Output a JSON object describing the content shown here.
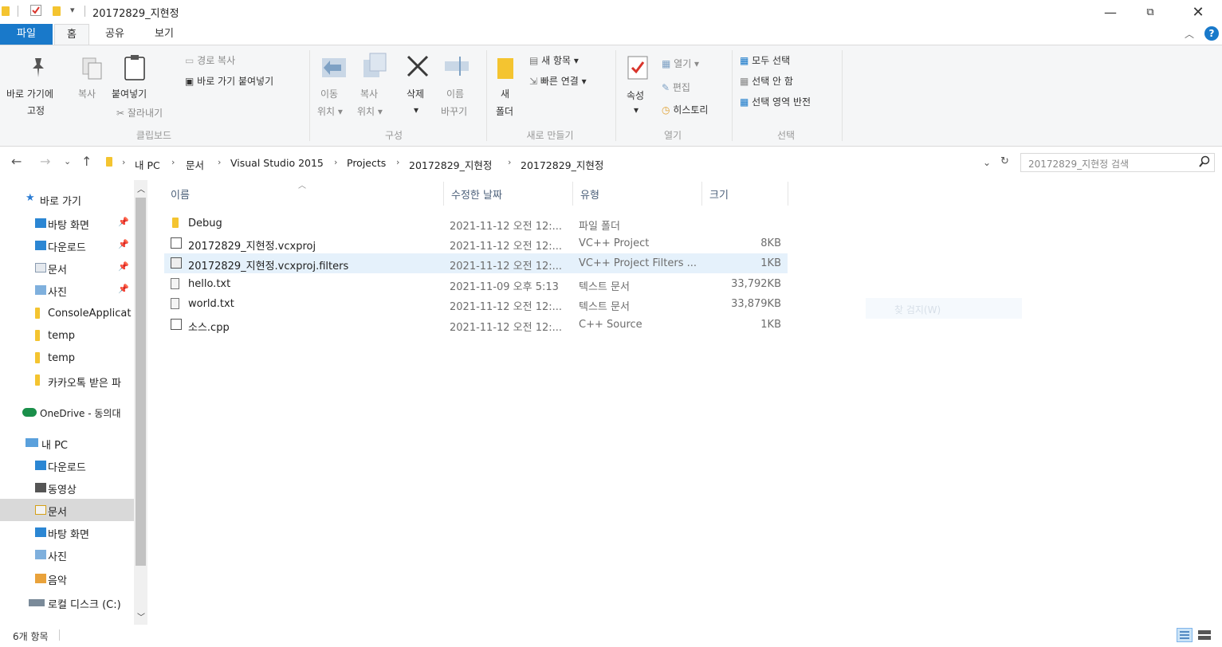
{
  "window": {
    "title": "20172829_지현정",
    "minimize_icon": "minimize-icon",
    "maximize_icon": "maximize-icon",
    "close_icon": "close-icon"
  },
  "ribbon_tabs": [
    "파일",
    "홈",
    "공유",
    "보기"
  ],
  "ribbon": {
    "clipboard": {
      "pin_label_1": "바로 가기에",
      "pin_label_2": "고정",
      "copy": "복사",
      "paste": "붙여넣기",
      "copy_path": "경로 복사",
      "paste_shortcut": "바로 가기 붙여넣기",
      "cut": "잘라내기",
      "group": "클립보드"
    },
    "organize": {
      "move_to_1": "이동",
      "move_to_2": "위치 ▾",
      "copy_to_1": "복사",
      "copy_to_2": "위치 ▾",
      "delete": "삭제",
      "delete_arrow": "▾",
      "rename_1": "이름",
      "rename_2": "바꾸기",
      "group": "구성"
    },
    "new": {
      "new_folder_1": "새",
      "new_folder_2": "폴더",
      "new_item": "새 항목 ▾",
      "easy_access": "빠른 연결 ▾",
      "group": "새로 만들기"
    },
    "open": {
      "properties": "속성",
      "properties_arrow": "▾",
      "open": "열기 ▾",
      "edit": "편집",
      "history": "히스토리",
      "group": "열기"
    },
    "select": {
      "select_all": "모두 선택",
      "select_none": "선택 안 함",
      "invert": "선택 영역 반전",
      "group": "선택"
    }
  },
  "address": {
    "crumbs": [
      "내 PC",
      "문서",
      "Visual Studio 2015",
      "Projects",
      "20172829_지현정",
      "20172829_지현정"
    ],
    "search_placeholder": "20172829_지현정 검색"
  },
  "nav_pane": {
    "quick_access": "바로 가기",
    "items": [
      {
        "label": "바탕 화면",
        "pinned": true
      },
      {
        "label": "다운로드",
        "pinned": true
      },
      {
        "label": "문서",
        "pinned": true
      },
      {
        "label": "사진",
        "pinned": true
      },
      {
        "label": "ConsoleApplicat",
        "pinned": false
      },
      {
        "label": "temp",
        "pinned": false
      },
      {
        "label": "temp",
        "pinned": false
      },
      {
        "label": "카카오톡 받은 파",
        "pinned": false
      }
    ],
    "onedrive": "OneDrive - 동의대",
    "this_pc": "내 PC",
    "pc_items": [
      "다운로드",
      "동영상",
      "문서",
      "바탕 화면",
      "사진",
      "음악",
      "로컬 디스크 (C:)"
    ]
  },
  "columns": {
    "name": "이름",
    "modified": "수정한 날짜",
    "type": "유형",
    "size": "크기"
  },
  "files": [
    {
      "name": "Debug",
      "modified": "2021-11-12 오전 12:...",
      "type": "파일 폴더",
      "size": "",
      "icon": "folder-icon"
    },
    {
      "name": "20172829_지현정.vcxproj",
      "modified": "2021-11-12 오전 12:...",
      "type": "VC++ Project",
      "size": "8KB",
      "icon": "vcxproj-icon"
    },
    {
      "name": "20172829_지현정.vcxproj.filters",
      "modified": "2021-11-12 오전 12:...",
      "type": "VC++ Project Filters ...",
      "size": "1KB",
      "icon": "filters-icon"
    },
    {
      "name": "hello.txt",
      "modified": "2021-11-09 오후 5:13",
      "type": "텍스트 문서",
      "size": "33,792KB",
      "icon": "text-file-icon"
    },
    {
      "name": "world.txt",
      "modified": "2021-11-12 오전 12:...",
      "type": "텍스트 문서",
      "size": "33,879KB",
      "icon": "text-file-icon"
    },
    {
      "name": "소스.cpp",
      "modified": "2021-11-12 오전 12:...",
      "type": "C++ Source",
      "size": "1KB",
      "icon": "cpp-file-icon"
    }
  ],
  "ghost_text": "찾 검지(W)",
  "status": {
    "count": "6개 항목"
  },
  "colors": {
    "accent": "#1979ca",
    "folder": "#f4c430",
    "selected_row": "#e5f1fb",
    "selected_nav": "#d9d9d9"
  }
}
